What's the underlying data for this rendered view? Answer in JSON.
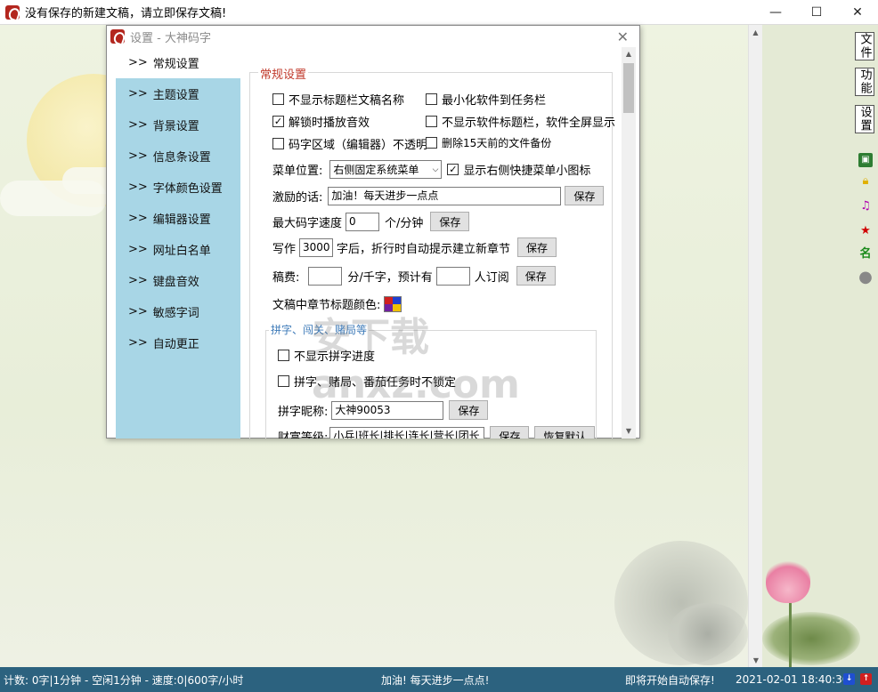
{
  "window": {
    "title": "没有保存的新建文稿，请立即保存文稿!",
    "minimize_glyph": "—",
    "maximize_glyph": "☐",
    "close_glyph": "✕"
  },
  "dialog": {
    "title": "设置 - 大神码字",
    "close_glyph": "✕",
    "nav": [
      {
        "label": "常规设置",
        "active": true
      },
      {
        "label": "主题设置"
      },
      {
        "label": "背景设置"
      },
      {
        "label": "信息条设置"
      },
      {
        "label": "字体颜色设置"
      },
      {
        "label": "编辑器设置"
      },
      {
        "label": "网址白名单"
      },
      {
        "label": "键盘音效"
      },
      {
        "label": "敏感字词"
      },
      {
        "label": "自动更正"
      }
    ],
    "nav_prefix": ">>",
    "general": {
      "group_title": "常规设置",
      "cb_hide_title_name": "不显示标题栏文稿名称",
      "cb_minimize_tray": "最小化软件到任务栏",
      "cb_unlock_sound": "解锁时播放音效",
      "cb_hide_titlebar": "不显示软件标题栏，软件全屏显示",
      "cb_editor_opaque": "码字区域（编辑器）不透明",
      "cb_delete_backup": "删除15天前的文件备份",
      "menu_position_label": "菜单位置:",
      "menu_position_value": "右侧固定系统菜单",
      "cb_show_menu_icons": "显示右侧快捷菜单小图标",
      "motto_label": "激励的话:",
      "motto_value": "加油！每天进步一点点",
      "save": "保存",
      "max_speed_label": "最大码字速度",
      "max_speed_value": "0",
      "max_speed_unit": "个/分钟",
      "chapter_prefix": "写作",
      "chapter_value": "3000",
      "chapter_suffix": "字后，折行时自动提示建立新章节",
      "fee_label": "稿费:",
      "fee_unit": "分/千字，预计有",
      "fee_subscribers": "人订阅",
      "chapter_color_label": "文稿中章节标题颜色:"
    },
    "game": {
      "group_title": "拼字、闯关、赌局等",
      "cb_hide_progress": "不显示拼字进度",
      "cb_no_lock": "拼字、赌局、番茄任务时不锁定",
      "nickname_label": "拼字昵称:",
      "nickname_value": "大神90053",
      "rank_label": "财富等级:",
      "rank_value": "小兵|班长|排长|连长|营长|团长",
      "save": "保存",
      "reset": "恢复默认"
    }
  },
  "right_toolbar": {
    "tab_file": "文件",
    "tab_function": "功能",
    "tab_settings": "设置"
  },
  "statusbar": {
    "left": "计数: 0字|1分钟 - 空闲1分钟 - 速度:0|600字/小时",
    "motto": "加油! 每天进步一点点!",
    "autosave": "即将开始自动保存!",
    "datetime": "2021-02-01 18:40:30"
  },
  "watermark": "安下载 anxz.com"
}
